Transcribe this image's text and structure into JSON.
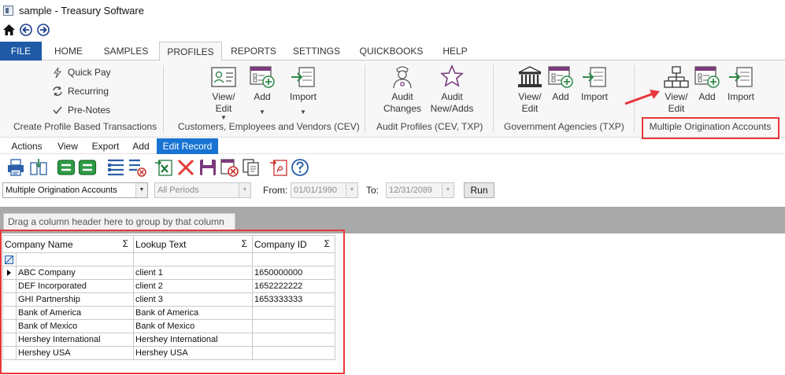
{
  "window": {
    "title": "sample - Treasury Software"
  },
  "quick_access": [
    {
      "name": "home-icon"
    },
    {
      "name": "back-icon"
    },
    {
      "name": "forward-icon"
    }
  ],
  "tabs": {
    "file": "FILE",
    "home": "HOME",
    "samples": "SAMPLES",
    "profiles": "PROFILES",
    "reports": "REPORTS",
    "settings": "SETTINGS",
    "quickbooks": "QUICKBOOKS",
    "help": "HELP",
    "active": "PROFILES"
  },
  "ribbon": {
    "group_create": {
      "label": "Create Profile Based Transactions",
      "quick_pay": "Quick Pay",
      "recurring": "Recurring",
      "pre_notes": "Pre-Notes"
    },
    "group_cev": {
      "label": "Customers, Employees and Vendors (CEV)",
      "view_edit_1": "View/",
      "view_edit_2": "Edit",
      "add": "Add",
      "import": "Import"
    },
    "group_audit": {
      "label": "Audit Profiles (CEV, TXP)",
      "changes_1": "Audit",
      "changes_2": "Changes",
      "new_adds_1": "Audit",
      "new_adds_2": "New/Adds"
    },
    "group_gov": {
      "label": "Government Agencies (TXP)",
      "view_edit_1": "View/",
      "view_edit_2": "Edit",
      "add": "Add",
      "import": "Import"
    },
    "group_moa": {
      "label": "Multiple Origination Accounts",
      "view_edit_1": "View/",
      "view_edit_2": "Edit",
      "add": "Add",
      "import": "Import"
    }
  },
  "menu": {
    "actions": "Actions",
    "view": "View",
    "export": "Export",
    "add": "Add",
    "edit_record": "Edit Record"
  },
  "toolbar_icons": [
    "print-icon",
    "print-preview-icon",
    "expand-all-icon",
    "collapse-all-icon",
    "column-chooser-icon",
    "clear-filter-icon",
    "export-excel-icon",
    "delete-icon",
    "save-icon",
    "cancel-edit-icon",
    "copy-icon",
    "export-pdf-icon",
    "help-icon"
  ],
  "filters": {
    "profile_type": "Multiple Origination Accounts",
    "period": "All Periods",
    "from_label": "From:",
    "from_date": "01/01/1990",
    "to_label": "To:",
    "to_date": "12/31/2089",
    "run_label": "Run"
  },
  "grid": {
    "group_hint": "Drag a column header here to group by that column",
    "columns": [
      {
        "label": "Company Name",
        "sigma": "Σ"
      },
      {
        "label": "Lookup Text",
        "sigma": "Σ"
      },
      {
        "label": "Company ID",
        "sigma": "Σ"
      }
    ],
    "rows": [
      [
        "ABC Company",
        "client 1",
        "1650000000"
      ],
      [
        "DEF Incorporated",
        "client 2",
        "1652222222"
      ],
      [
        "GHI Partnership",
        "client 3",
        "1653333333"
      ],
      [
        "Bank of America",
        "Bank of America",
        ""
      ],
      [
        "Bank of Mexico",
        "Bank of Mexico",
        ""
      ],
      [
        "Hershey International",
        "Hershey International",
        ""
      ],
      [
        "Hershey USA",
        "Hershey USA",
        ""
      ]
    ]
  },
  "colors": {
    "file_tab": "#1e5aa6",
    "edit_record": "#1873d3",
    "annotation": "#e8373b"
  }
}
